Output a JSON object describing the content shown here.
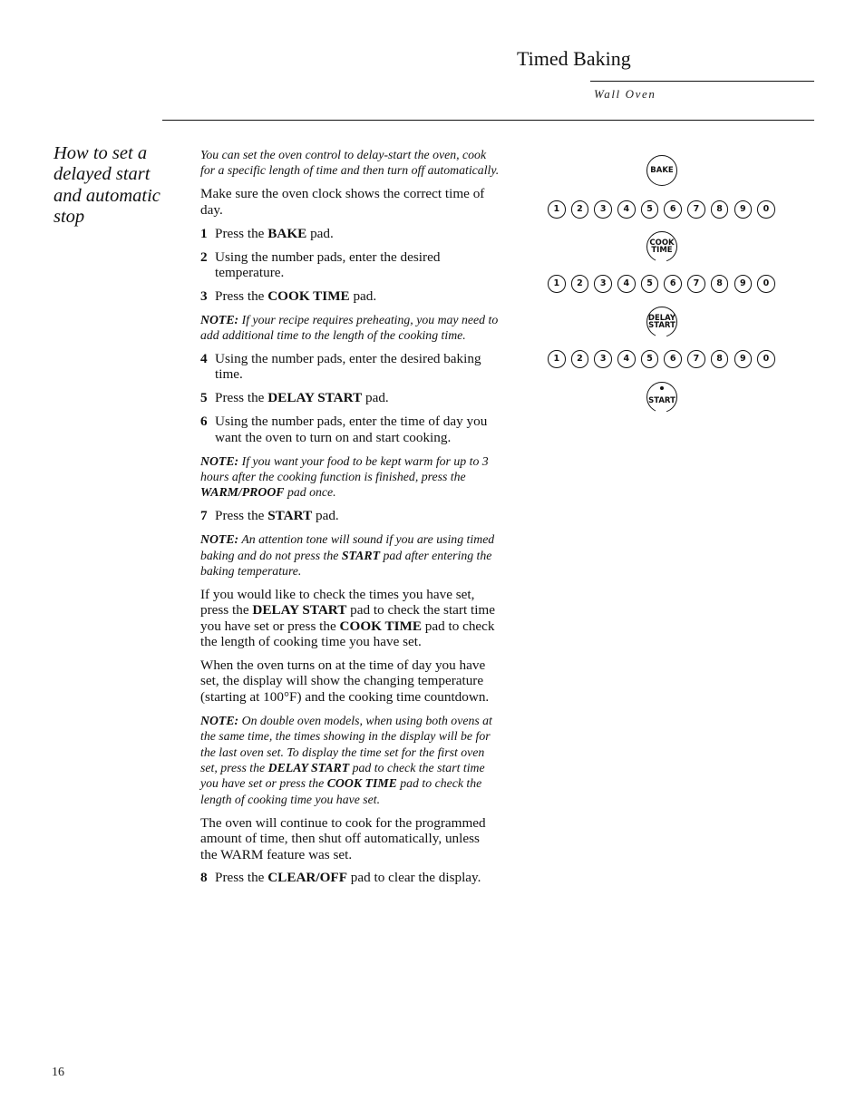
{
  "header": {
    "title": "Timed Baking",
    "subtitle": "Wall Oven"
  },
  "side_heading": "How to set a delayed start and automatic stop",
  "intro": "You can set the oven control to delay-start the oven, cook for a specific length of time and then turn off automatically.",
  "clock_text": "Make sure the oven clock shows the correct time of day.",
  "steps": [
    {
      "num": "1",
      "pre": "Press the ",
      "bold": "BAKE",
      "post": " pad."
    },
    {
      "num": "2",
      "pre": "Using the number pads, enter the desired temperature.",
      "bold": "",
      "post": ""
    },
    {
      "num": "3",
      "pre": "Press the ",
      "bold": "COOK TIME",
      "post": " pad."
    },
    {
      "num": "4",
      "pre": "Using the number pads, enter the desired baking time.",
      "bold": "",
      "post": ""
    },
    {
      "num": "5",
      "pre": "Press the ",
      "bold": "DELAY START",
      "post": " pad."
    },
    {
      "num": "6",
      "pre": "Using the number pads, enter the time of day you want the oven to turn on and start cooking.",
      "bold": "",
      "post": ""
    },
    {
      "num": "7",
      "pre": "Press the ",
      "bold": "START",
      "post": " pad."
    },
    {
      "num": "8",
      "pre": "Press the ",
      "bold": "CLEAR/OFF",
      "post": " pad to clear the display."
    }
  ],
  "notes": {
    "label": "NOTE:",
    "preheat": " If your recipe requires preheating, you may need to add additional time to the length of the cooking time.",
    "warm_pre": " If you want your food to be kept warm for up to 3 hours after the cooking function is finished, press the ",
    "warm_bold": "WARM/PROOF",
    "warm_post": " pad once.",
    "tone_pre": " An attention tone will sound if you are using timed baking and do not press the ",
    "tone_bold": "START",
    "tone_post": " pad after entering the baking temperature.",
    "double_pre": " On double oven models, when using both ovens at the same time, the times showing in the display will be for the last oven set. To display the time set for the first oven set, press the ",
    "double_bold1": "DELAY START",
    "double_mid": " pad to check the start time you have set or press the ",
    "double_bold2": "COOK TIME",
    "double_post": " pad to check the length of cooking time you have set."
  },
  "check_para": {
    "pre": "If you would like to check the times you have set, press the ",
    "bold1": "DELAY START",
    "mid": " pad to check the start time you have set or press the ",
    "bold2": "COOK TIME",
    "post": " pad to check the length of cooking time you have set."
  },
  "turn_on_para": "When the oven turns on at the time of day you have set, the display will show the changing temperature (starting at 100°F) and the cooking time countdown.",
  "continue_para": "The oven will continue to cook for the programmed amount of time, then shut off automatically, unless the WARM feature was set.",
  "keypad": {
    "bake": "BAKE",
    "cook_time": [
      "COOK",
      "TIME"
    ],
    "delay_start": [
      "DELAY",
      "START"
    ],
    "start": "START",
    "digits": [
      "1",
      "2",
      "3",
      "4",
      "5",
      "6",
      "7",
      "8",
      "9",
      "0"
    ]
  },
  "page_number": "16"
}
